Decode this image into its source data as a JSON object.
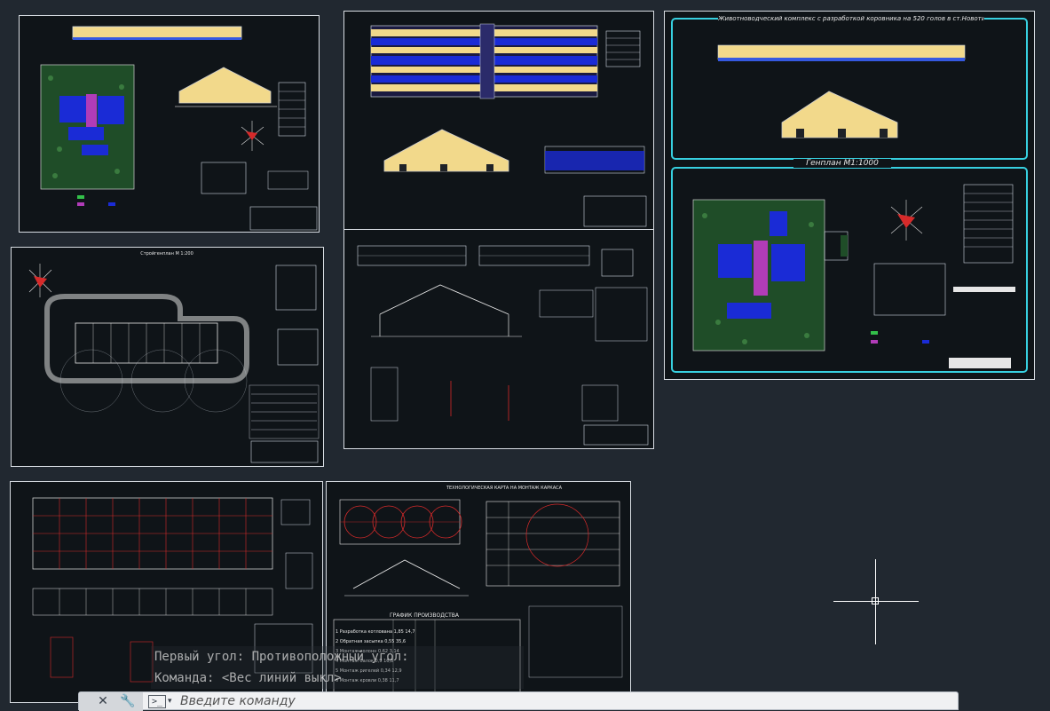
{
  "drawing": {
    "right_sheet_title": "Животноводческий комплекс с разработкой коровника на 520 голов в ст.Новотиторовской",
    "genplan_title": "Генплан М1:1000",
    "stroygenplan_title": "Стройгенплан М 1:200",
    "grafik_title": "ГРАФИК ПРОИЗВОДСТВА",
    "tech_map_title": "ТЕХНОЛОГИЧЕСКАЯ КАРТА НА МОНТАЖ КАРКАСА",
    "grafik_rows": [
      {
        "n": "1",
        "name": "Разработка котлована",
        "q": "1,85",
        "v": "14,7"
      },
      {
        "n": "2",
        "name": "Обратная засыпка",
        "q": "0,55",
        "v": "35,6"
      },
      {
        "n": "3",
        "name": "Монтаж колонн",
        "q": "0,62",
        "v": "3,14"
      },
      {
        "n": "4",
        "name": "Монтаж балок",
        "q": "0,9",
        "v": "16,8"
      },
      {
        "n": "5",
        "name": "Монтаж ригелей",
        "q": "0,34",
        "v": "12,9"
      },
      {
        "n": "6",
        "name": "Монтаж кровли",
        "q": "0,38",
        "v": "11,7"
      }
    ]
  },
  "command_history": [
    "Первый угол: Противоположный угол:",
    "Команда:  <Вес линий выкл>"
  ],
  "command_line": {
    "placeholder": "Введите команду",
    "close_symbol": "✕",
    "wrench_symbol": "🔧",
    "prompt_symbol": ">_",
    "dropdown_symbol": "▾"
  },
  "colors": {
    "background": "#212830",
    "sheet_border": "#d8dde3",
    "building_fill": "#f2d98b",
    "blue_plan": "#1a2bd6",
    "magenta": "#b13cb8",
    "red_grid": "#d62a2a",
    "frame_cyan": "#37d0e0"
  }
}
